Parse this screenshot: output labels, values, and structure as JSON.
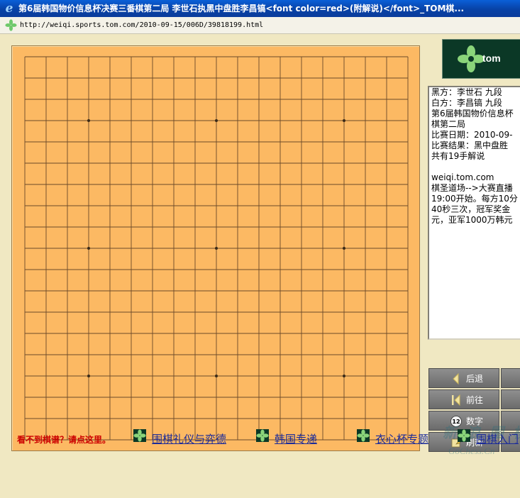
{
  "window": {
    "title": "第6届韩国物价信息杯决赛三番棋第二局  李世石执黑中盘胜李昌镐<font color=red>(附解说)</font>_TOM棋..."
  },
  "address": {
    "url": "http://weiqi.sports.tom.com/2010-09-15/006D/39818199.html"
  },
  "logo": {
    "text": "tom",
    "icon": "tom-leaf-icon"
  },
  "board": {
    "size": 19,
    "star_points": [
      [
        3,
        3
      ],
      [
        3,
        9
      ],
      [
        3,
        15
      ],
      [
        9,
        3
      ],
      [
        9,
        9
      ],
      [
        9,
        15
      ],
      [
        15,
        3
      ],
      [
        15,
        9
      ],
      [
        15,
        15
      ]
    ],
    "colors": {
      "wood": "#fcb963",
      "line": "#6b4a2a"
    }
  },
  "info": {
    "lines": [
      "黑方：李世石 九段",
      "白方：李昌镐 九段",
      "第6届韩国物价信息杯",
      "棋第二局",
      "比赛日期：2010-09-",
      "比赛结果：黑中盘胜",
      "共有19手解说",
      "",
      "weiqi.tom.com",
      "棋圣道场-->大赛直播",
      "19:00开始。每方10分",
      "40秒三次，冠军奖金",
      "元，亚军1000万韩元"
    ]
  },
  "controls": [
    {
      "label": "后退",
      "icon": "back-arrow-icon"
    },
    {
      "label": "前往",
      "icon": "forward-arrow-icon"
    },
    {
      "label": "数字",
      "icon": "number-icon",
      "badge": "12"
    },
    {
      "label": "刷新",
      "icon": "refresh-icon"
    }
  ],
  "bottom": {
    "notice": "看不到棋谱？请点这里。",
    "links": [
      {
        "label": "围棋礼仪与弈德"
      },
      {
        "label": "韩国专递"
      },
      {
        "label": "衣心杯专题"
      },
      {
        "label": "围棋入门"
      }
    ]
  },
  "watermark": {
    "line1": "新 浪 围 棋",
    "line2": "GoChess.Cn"
  }
}
